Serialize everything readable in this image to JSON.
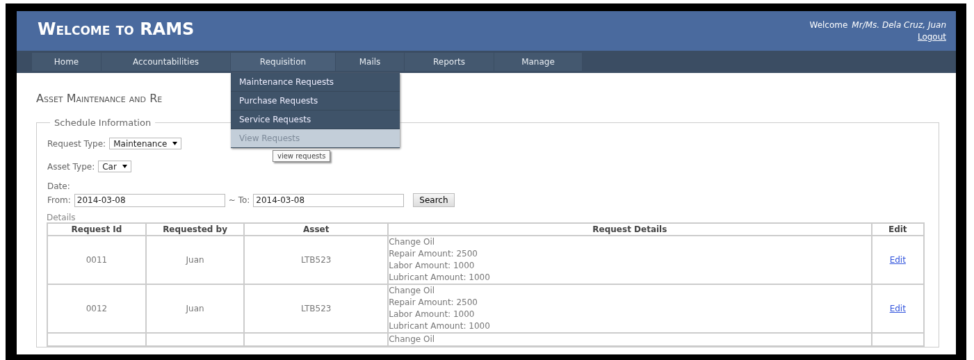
{
  "header": {
    "title": "Welcome to RAMS",
    "welcome_label": "Welcome",
    "user_name": "Mr/Ms. Dela Cruz, Juan",
    "logout": "Logout"
  },
  "nav": [
    {
      "label": "Home"
    },
    {
      "label": "Accountabilities"
    },
    {
      "label": "Requisition",
      "menu": [
        {
          "label": "Maintenance Requests",
          "selected": false
        },
        {
          "label": "Purchase Requests",
          "selected": false
        },
        {
          "label": "Service Requests",
          "selected": false
        },
        {
          "label": "View Requests",
          "selected": true
        }
      ]
    },
    {
      "label": "Mails"
    },
    {
      "label": "Reports"
    },
    {
      "label": "Manage"
    }
  ],
  "tooltip": "view requests",
  "page_title": "Asset Maintenance and Re",
  "schedule": {
    "legend": "Schedule Information",
    "request_type_label": "Request Type:",
    "request_type": "Maintenance",
    "asset_type_label": "Asset Type:",
    "asset_type": "Car",
    "date_label": "Date:",
    "from_label": "From:",
    "from": "2014-03-08",
    "to_label": "~ To:",
    "to": "2014-03-08",
    "search": "Search"
  },
  "details": {
    "label": "Details",
    "columns": [
      "Request Id",
      "Requested by",
      "Asset",
      "Request Details",
      "Edit"
    ],
    "rows": [
      {
        "request_id": "0011",
        "requested_by": "Juan",
        "asset": "LTB523",
        "details": [
          "Change Oil",
          "Repair Amount: 2500",
          "Labor Amount: 1000",
          "Lubricant Amount: 1000"
        ],
        "edit": "Edit"
      },
      {
        "request_id": "0012",
        "requested_by": "Juan",
        "asset": "LTB523",
        "details": [
          "Change Oil",
          "Repair Amount: 2500",
          "Labor Amount: 1000",
          "Lubricant Amount: 1000"
        ],
        "edit": "Edit"
      },
      {
        "details": [
          "Change Oil"
        ]
      }
    ]
  }
}
